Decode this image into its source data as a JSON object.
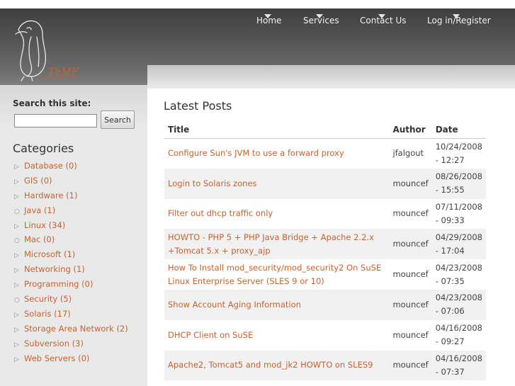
{
  "nav": {
    "items": [
      {
        "label": "Home"
      },
      {
        "label": "Services"
      },
      {
        "label": "Contact Us"
      },
      {
        "label": "Log in/Register"
      }
    ]
  },
  "logo": {
    "text": "ThMF"
  },
  "search": {
    "title": "Search this site:",
    "placeholder": "",
    "value": "",
    "button_label": "Search"
  },
  "categories": {
    "title": "Categories",
    "items": [
      {
        "label": "Database (0)",
        "bullet": "triangle"
      },
      {
        "label": "GIS (0)",
        "bullet": "triangle"
      },
      {
        "label": "Hardware (1)",
        "bullet": "triangle"
      },
      {
        "label": "Java (1)",
        "bullet": "circle"
      },
      {
        "label": "Linux (34)",
        "bullet": "triangle"
      },
      {
        "label": "Mac (0)",
        "bullet": "circle"
      },
      {
        "label": "Microsoft (1)",
        "bullet": "triangle"
      },
      {
        "label": "Networking (1)",
        "bullet": "triangle"
      },
      {
        "label": "Programming (0)",
        "bullet": "triangle"
      },
      {
        "label": "Security (5)",
        "bullet": "circle"
      },
      {
        "label": "Solaris (17)",
        "bullet": "triangle"
      },
      {
        "label": "Storage Area Network (2)",
        "bullet": "triangle"
      },
      {
        "label": "Subversion (3)",
        "bullet": "triangle"
      },
      {
        "label": "Web Servers (0)",
        "bullet": "triangle"
      }
    ]
  },
  "posts": {
    "title": "Latest Posts",
    "headers": {
      "title": "Title",
      "author": "Author",
      "date": "Date"
    },
    "rows": [
      {
        "title": "Configure Sun's JVM to use a forward proxy",
        "author": "jfalgout",
        "date": "10/24/2008 - 12:27"
      },
      {
        "title": "Login to Solaris zones",
        "author": "mouncef",
        "date": "08/26/2008 - 15:55"
      },
      {
        "title": "Filter out dhcp traffic only",
        "author": "mouncef",
        "date": "07/11/2008 - 09:33"
      },
      {
        "title": "HOWTO - PHP 5 + PHP Java Bridge + Apache 2.2.x +Tomcat 5.x + proxy_ajp",
        "author": "mouncef",
        "date": "04/29/2008 - 17:04"
      },
      {
        "title": "How To Install mod_security/mod_security2 On SuSE Linux Enterprise Server (SLES 9 or 10)",
        "author": "mouncef",
        "date": "04/23/2008 - 07:35"
      },
      {
        "title": "Show Account Aging Information",
        "author": "mouncef",
        "date": "04/23/2008 - 07:06"
      },
      {
        "title": "DHCP Client on SuSE",
        "author": "mouncef",
        "date": "04/16/2008 - 09:27"
      },
      {
        "title": "Apache2, Tomcat5 and mod_jk2 HOWTO on SLES9",
        "author": "mouncef",
        "date": "04/16/2008 - 07:37"
      }
    ]
  },
  "colors": {
    "link": "#c8632e",
    "header_dark": "#3f3f3f",
    "nav_text": "#f2f2f2"
  }
}
